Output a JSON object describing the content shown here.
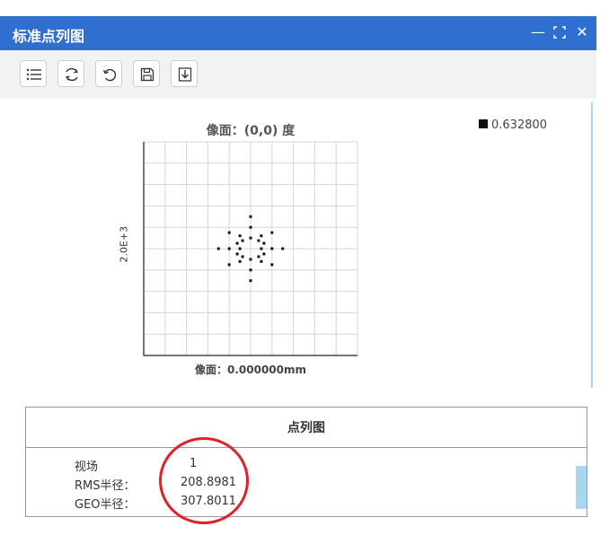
{
  "window": {
    "title": "标准点列图",
    "controls": {
      "minimize": "—",
      "maximize": "⛶",
      "close": "✕"
    }
  },
  "toolbar": {
    "buttons": [
      "list-icon",
      "refresh-icon",
      "undo-icon",
      "save-icon",
      "download-icon"
    ]
  },
  "plot": {
    "title": "像面：(0,0) 度",
    "xlabel": "像面：0.000000mm",
    "ylabel": "2.0E+3",
    "legend": [
      {
        "label": "0.632800",
        "color": "#111111"
      }
    ]
  },
  "chart_data": {
    "type": "scatter",
    "title": "像面：(0,0) 度",
    "xlabel": "像面：0.000000mm",
    "ylabel": "2.0E+3",
    "grid": true,
    "xlim": [
      -1000,
      1000
    ],
    "ylim": [
      -1000,
      1000
    ],
    "series": [
      {
        "name": "0.632800",
        "color": "#111111",
        "x": [
          0,
          0,
          0,
          0,
          0,
          0,
          -100,
          100,
          -200,
          200,
          -300,
          300,
          -200,
          200,
          -200,
          200,
          -100,
          100,
          -100,
          100,
          -75,
          75,
          -75,
          75,
          -125,
          125,
          -125,
          125
        ],
        "y": [
          300,
          200,
          100,
          -100,
          -200,
          -300,
          0,
          0,
          0,
          0,
          0,
          0,
          150,
          150,
          -150,
          -150,
          120,
          120,
          -120,
          -120,
          75,
          75,
          -75,
          -75,
          -50,
          -50,
          50,
          50
        ]
      }
    ]
  },
  "panel": {
    "title": "点列图",
    "rows": [
      {
        "label": "视场",
        "value": "1"
      },
      {
        "label": "RMS半径：",
        "value": "208.8981"
      },
      {
        "label": "GEO半径：",
        "value": "307.8011"
      }
    ]
  },
  "colors": {
    "titlebar": "#2f6fcf",
    "accent": "#a8d8f0",
    "highlight": "#e0202a"
  }
}
